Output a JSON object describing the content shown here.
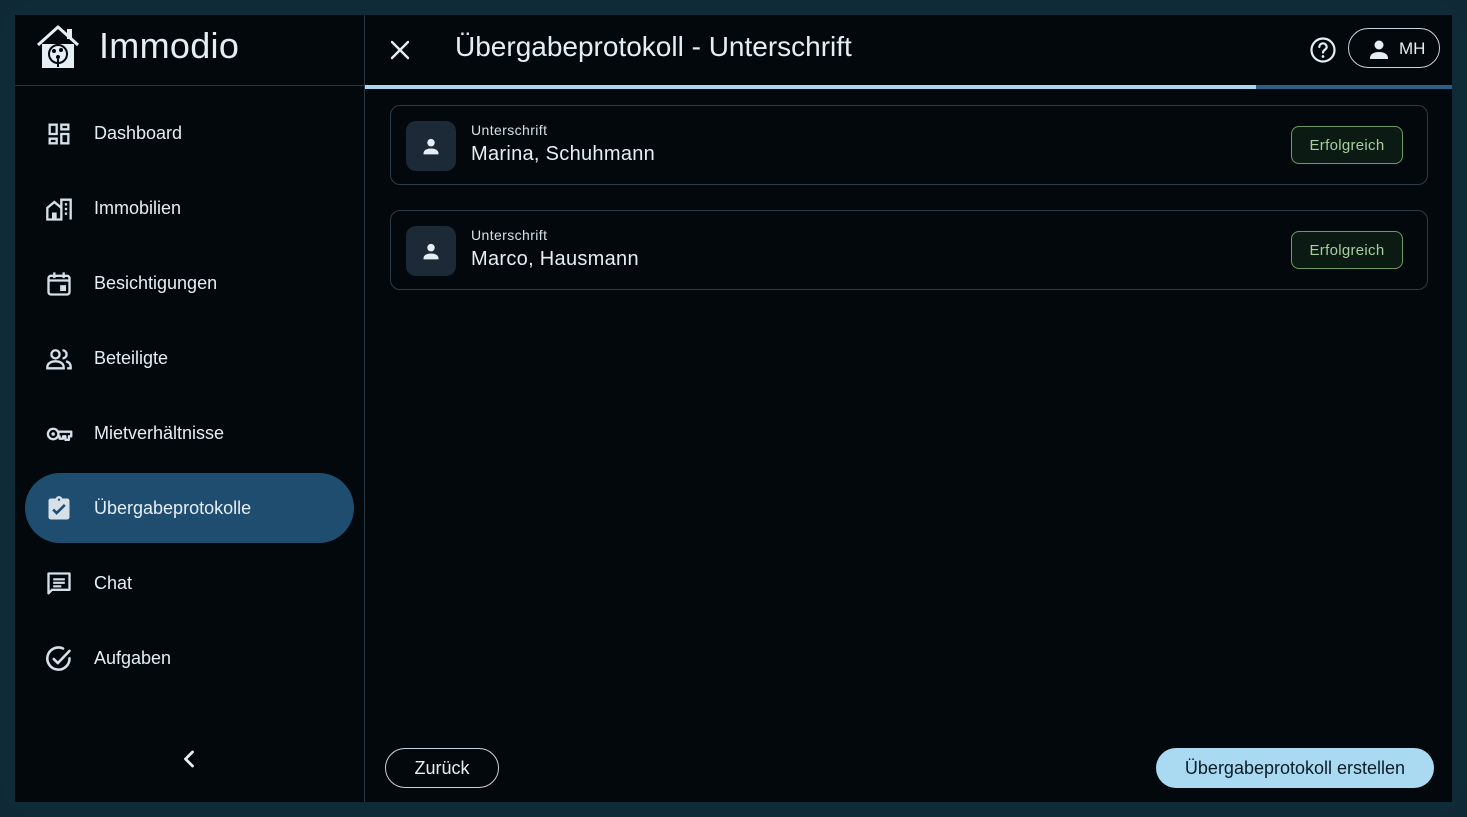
{
  "app": {
    "name": "Immodio",
    "logo_icon": "house-tree-logo-icon"
  },
  "sidebar": {
    "items": [
      {
        "label": "Dashboard",
        "icon": "dashboard-icon",
        "active": false
      },
      {
        "label": "Immobilien",
        "icon": "building-icon",
        "active": false
      },
      {
        "label": "Besichtigungen",
        "icon": "calendar-icon",
        "active": false
      },
      {
        "label": "Beteiligte",
        "icon": "people-icon",
        "active": false
      },
      {
        "label": "Mietverhältnisse",
        "icon": "key-icon",
        "active": false
      },
      {
        "label": "Übergabeprotokolle",
        "icon": "clipboard-check-icon",
        "active": true
      },
      {
        "label": "Chat",
        "icon": "chat-icon",
        "active": false
      },
      {
        "label": "Aufgaben",
        "icon": "check-circle-icon",
        "active": false
      }
    ],
    "collapse_icon": "chevron-left-icon"
  },
  "header": {
    "title": "Übergabeprotokoll - Unterschrift",
    "user_initials": "MH",
    "progress_fraction": 0.82
  },
  "signatures": [
    {
      "caption": "Unterschrift",
      "name": "Marina, Schuhmann",
      "status": "Erfolgreich"
    },
    {
      "caption": "Unterschrift",
      "name": "Marco, Hausmann",
      "status": "Erfolgreich"
    }
  ],
  "footer": {
    "back_label": "Zurück",
    "create_label": "Übergabeprotokoll erstellen"
  },
  "colors": {
    "accent": "#a9daf2",
    "active_nav": "#1f4d70",
    "success": "#a7cf9f",
    "background": "#03080c"
  }
}
